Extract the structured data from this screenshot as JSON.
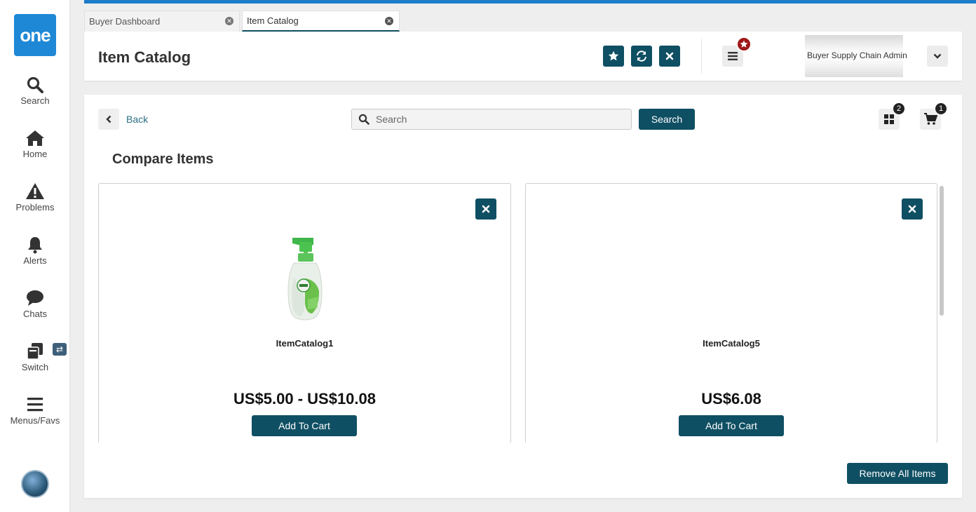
{
  "app": {
    "logo_text": "one"
  },
  "nav": {
    "items": [
      {
        "label": "Search",
        "icon": "search-icon"
      },
      {
        "label": "Home",
        "icon": "home-icon"
      },
      {
        "label": "Problems",
        "icon": "warning-icon"
      },
      {
        "label": "Alerts",
        "icon": "bell-icon"
      },
      {
        "label": "Chats",
        "icon": "chat-bubble-icon"
      },
      {
        "label": "Switch",
        "icon": "switch-icon"
      },
      {
        "label": "Menus/Favs",
        "icon": "hamburger-icon"
      }
    ],
    "switch_badge": "⇄"
  },
  "tabs": [
    {
      "label": "Buyer Dashboard",
      "active": false
    },
    {
      "label": "Item Catalog",
      "active": true
    }
  ],
  "header": {
    "title": "Item Catalog",
    "user_role": "Buyer Supply Chain Admin",
    "actions": [
      "favorite-star-icon",
      "refresh-icon",
      "close-icon"
    ]
  },
  "toolbar": {
    "back_label": "Back",
    "search_placeholder": "Search",
    "search_button": "Search",
    "compare_count": "2",
    "cart_count": "1"
  },
  "compare": {
    "title": "Compare Items",
    "items": [
      {
        "name": "ItemCatalog1",
        "price": "US$5.00 - US$10.08",
        "button": "Add To Cart",
        "has_image": true
      },
      {
        "name": "ItemCatalog5",
        "price": "US$6.08",
        "button": "Add To Cart",
        "has_image": false
      }
    ],
    "remove_all": "Remove All Items"
  },
  "colors": {
    "primary": "#0f4f63",
    "accent_blue": "#1e88d6",
    "badge_red": "#a01818"
  }
}
